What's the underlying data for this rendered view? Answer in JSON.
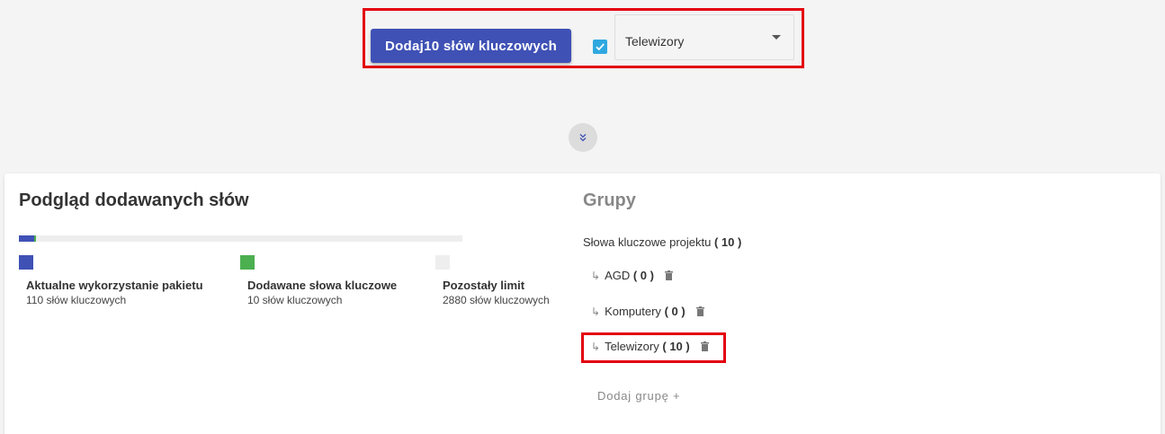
{
  "toolbar": {
    "add_button_label": "Dodaj10 słów kluczowych",
    "checkbox_checked": true,
    "group_select_value": "Telewizory"
  },
  "preview": {
    "title": "Podgląd dodawanych słów",
    "usage_bar": {
      "used_fraction": 0.034,
      "added_fraction": 0.003
    },
    "legend": [
      {
        "title": "Aktualne wykorzystanie pakietu",
        "subtitle": "110 słów kluczowych",
        "color": "#3f51b5"
      },
      {
        "title": "Dodawane słowa kluczowe",
        "subtitle": "10 słów kluczowych",
        "color": "#4caf50"
      },
      {
        "title": "Pozostały limit",
        "subtitle": "2880 słów kluczowych",
        "color": "#eeeeee"
      }
    ]
  },
  "groups": {
    "title": "Grupy",
    "project_label": "Słowa kluczowe projektu",
    "project_count": "( 10 )",
    "items": [
      {
        "arrow": "↳",
        "name": "AGD",
        "count": "( 0 )"
      },
      {
        "arrow": "↳",
        "name": "Komputery",
        "count": "( 0 )"
      },
      {
        "arrow": "↳",
        "name": "Telewizory",
        "count": "( 10 )"
      }
    ],
    "add_group_label": "Dodaj grupę +"
  },
  "colors": {
    "primary": "#3f51b5",
    "added": "#4caf50",
    "highlight": "#e3000f",
    "checkbox": "#2fa8e0"
  }
}
